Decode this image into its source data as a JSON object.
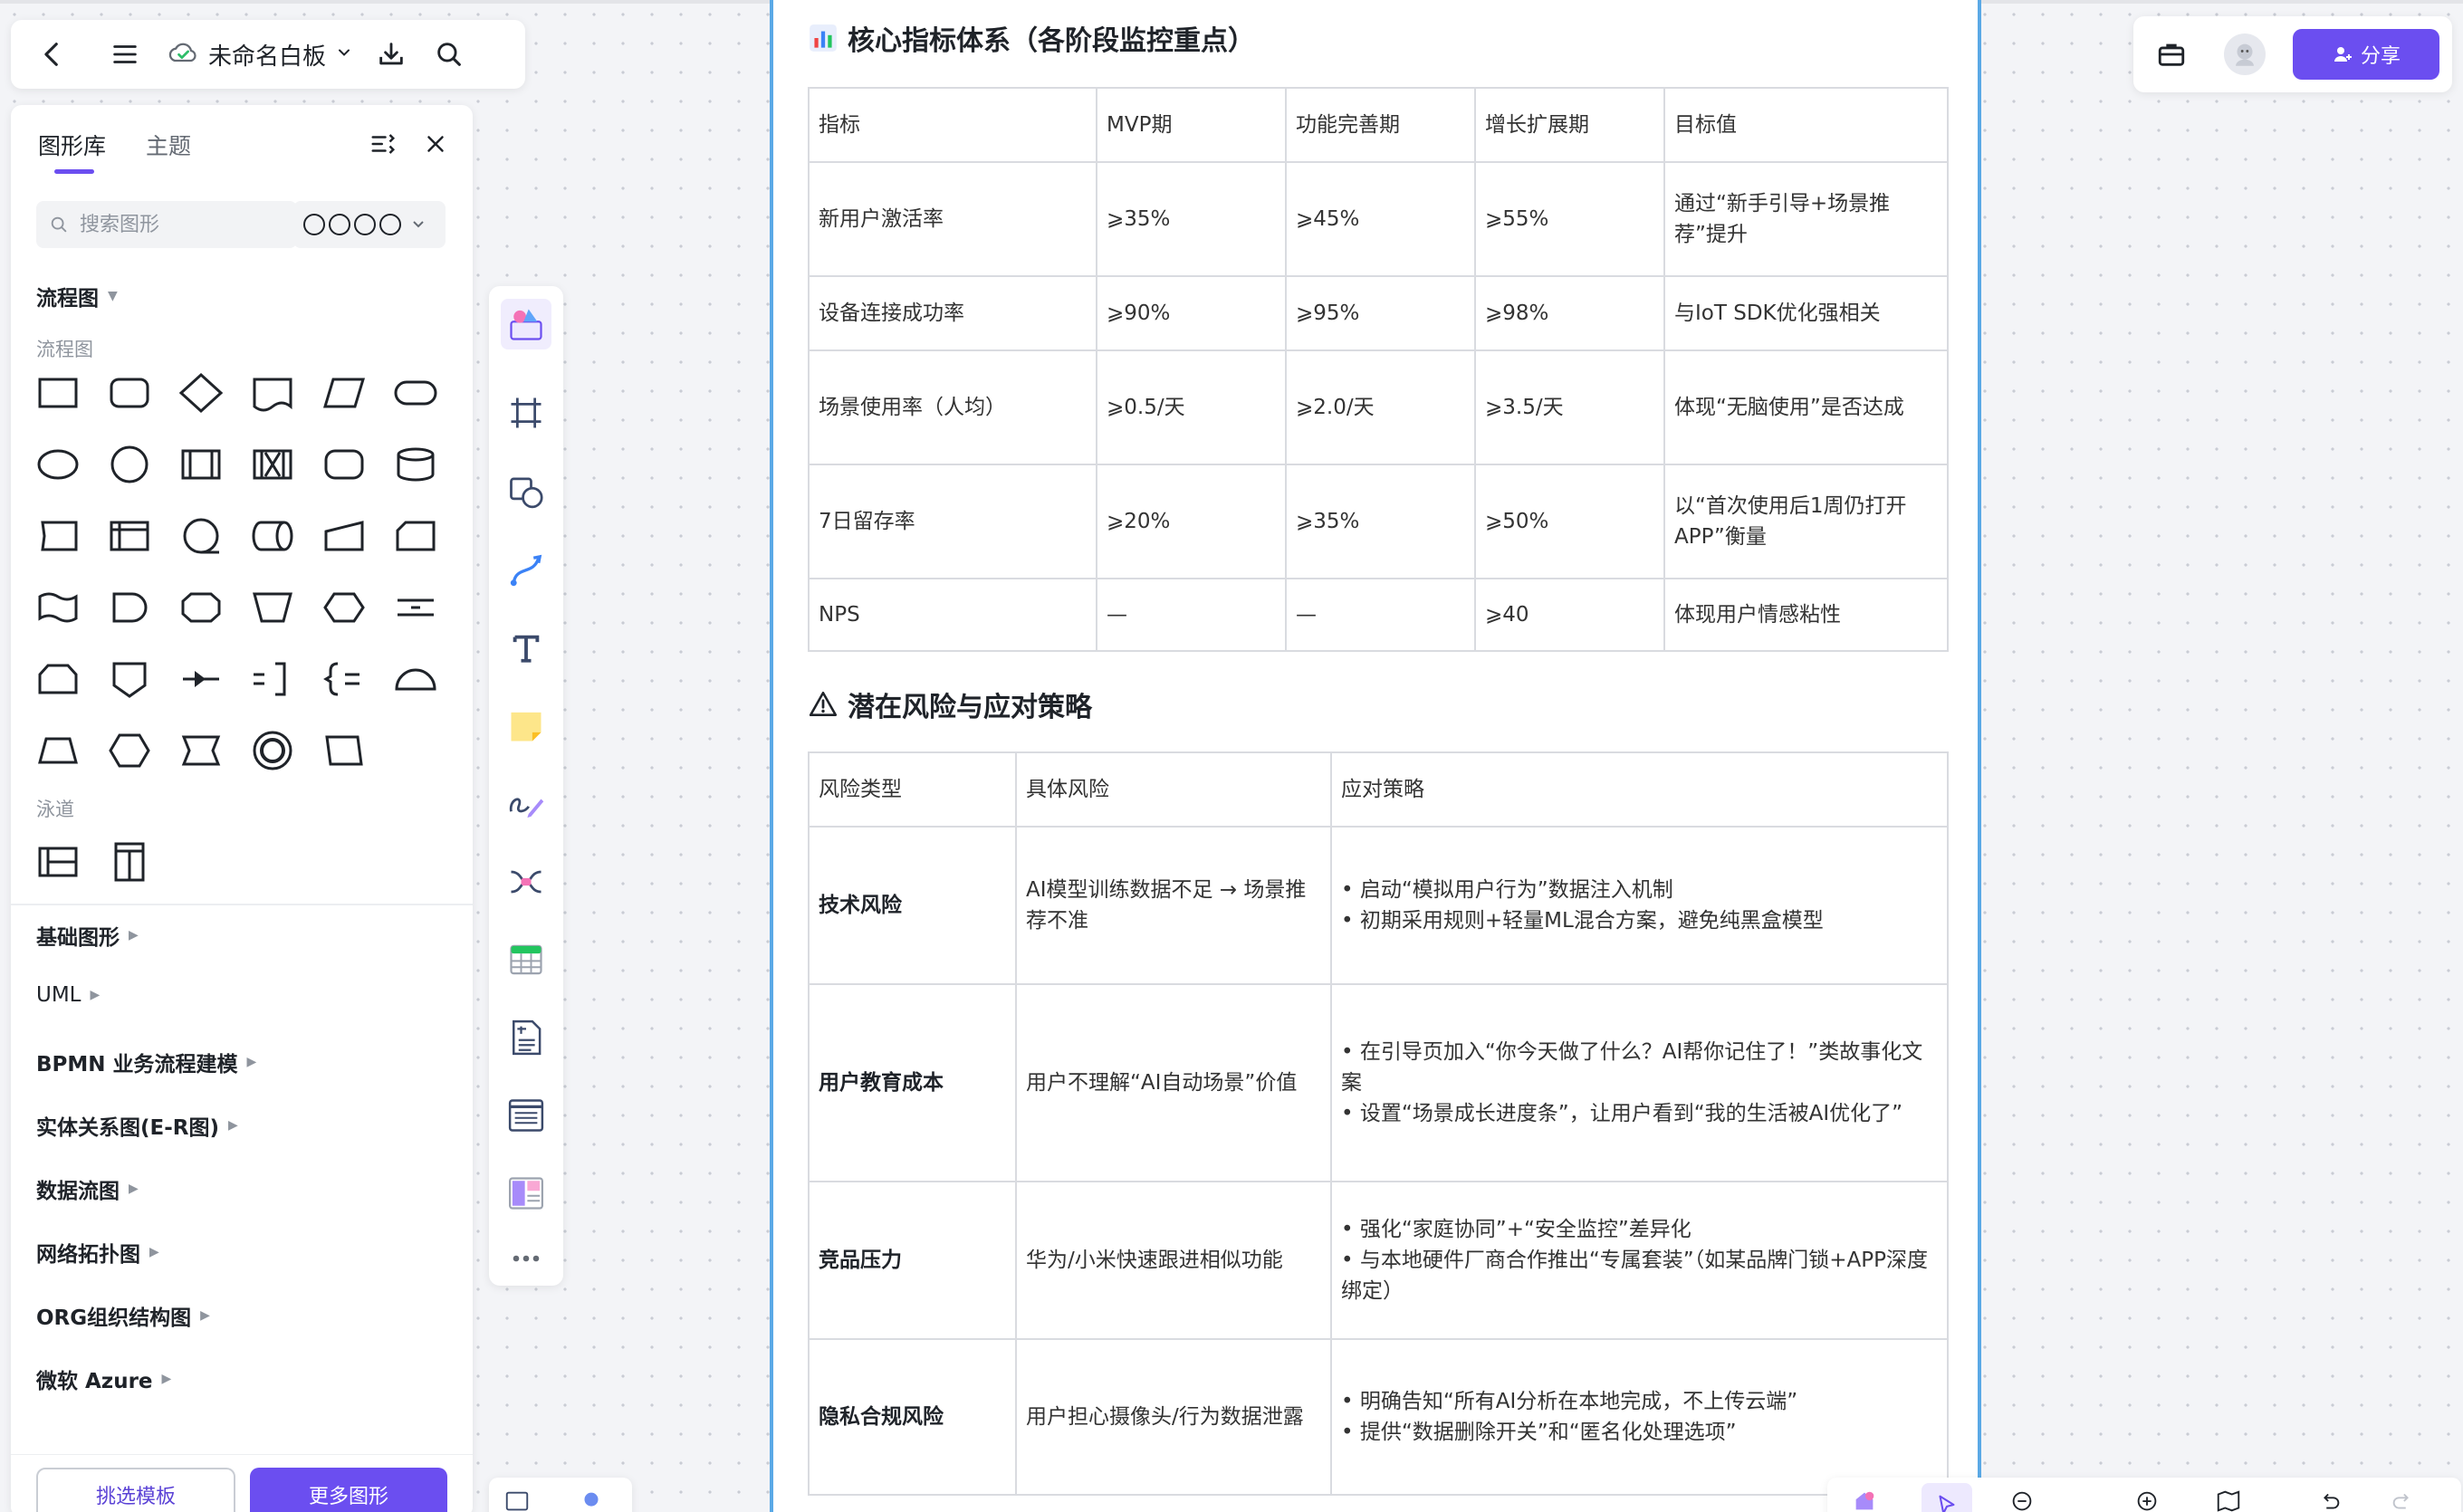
{
  "app": {
    "board_title": "未命名白板"
  },
  "topbar_right": {
    "share_label": "分享"
  },
  "library": {
    "tabs": [
      {
        "label": "图形库",
        "active": true
      },
      {
        "label": "主题",
        "active": false
      }
    ],
    "search_placeholder": "搜索图形",
    "flowchart_section": "流程图",
    "flowchart_sub": "流程图",
    "lane_sub": "泳道",
    "categories": [
      "基础图形",
      "UML",
      "BPMN 业务流程建模",
      "实体关系图(E-R图)",
      "数据流图",
      "网络拓扑图",
      "ORG组织结构图",
      "微软 Azure"
    ],
    "template_button": "挑选模板",
    "more_button": "更多图形"
  },
  "doc": {
    "metrics_title": "核心指标体系（各阶段监控重点）",
    "metrics_table": {
      "headers": [
        "指标",
        "MVP期",
        "功能完善期",
        "增长扩展期",
        "目标值"
      ],
      "rows": [
        [
          "新用户激活率",
          "⩾35%",
          "⩾45%",
          "⩾55%",
          "通过“新手引导+场景推荐”提升"
        ],
        [
          "设备连接成功率",
          "⩾90%",
          "⩾95%",
          "⩾98%",
          "与IoT SDK优化强相关"
        ],
        [
          "场景使用率（人均）",
          "⩾0.5/天",
          "⩾2.0/天",
          "⩾3.5/天",
          "体现“无脑使用”是否达成"
        ],
        [
          "7日留存率",
          "⩾20%",
          "⩾35%",
          "⩾50%",
          "以“首次使用后1周仍打开APP”衡量"
        ],
        [
          "NPS",
          "—",
          "—",
          "⩾40",
          "体现用户情感粘性"
        ]
      ]
    },
    "risk_title": "潜在风险与应对策略",
    "risk_table": {
      "headers": [
        "风险类型",
        "具体风险",
        "应对策略"
      ],
      "rows": [
        {
          "type": "技术风险",
          "risk": "AI模型训练数据不足 → 场景推荐不准",
          "strategies": [
            "• 启动“模拟用户行为”数据注入机制",
            "• 初期采用规则+轻量ML混合方案，避免纯黑盒模型"
          ]
        },
        {
          "type": "用户教育成本",
          "risk": "用户不理解“AI自动场景”价值",
          "strategies": [
            "• 在引导页加入“你今天做了什么？AI帮你记住了！”类故事化文案",
            "• 设置“场景成长进度条”，让用户看到“我的生活被AI优化了”"
          ]
        },
        {
          "type": "竞品压力",
          "risk": "华为/小米快速跟进相似功能",
          "strategies": [
            "• 强化“家庭协同”+“安全监控”差异化",
            "• 与本地硬件厂商合作推出“专属套装”（如某品牌门锁+APP深度绑定）"
          ]
        },
        {
          "type": "隐私合规风险",
          "risk": "用户担心摄像头/行为数据泄露",
          "strategies": [
            "• 明确告知“所有AI分析在本地完成，不上传云端”",
            "• 提供“数据删除开关”和“匿名化处理选项”"
          ]
        }
      ]
    }
  },
  "colors": {
    "accent": "#6b4ef0",
    "frame_border": "#5aa9e6",
    "canvas_bg": "#f3f4f7"
  },
  "icons": {
    "topbar_left": [
      "back-icon",
      "menu-icon",
      "cloud-synced-icon",
      "chevron-down-icon",
      "download-icon",
      "search-icon"
    ],
    "topbar_right": [
      "briefcase-icon",
      "avatar",
      "add-user-icon"
    ],
    "vertical_tools": [
      "shape-library-icon",
      "frame-icon",
      "shapes-icon",
      "connector-icon",
      "text-icon",
      "sticky-note-icon",
      "pen-icon",
      "mind-map-icon",
      "table-icon",
      "document-icon",
      "list-icon",
      "layout-icon",
      "more-icon"
    ]
  }
}
